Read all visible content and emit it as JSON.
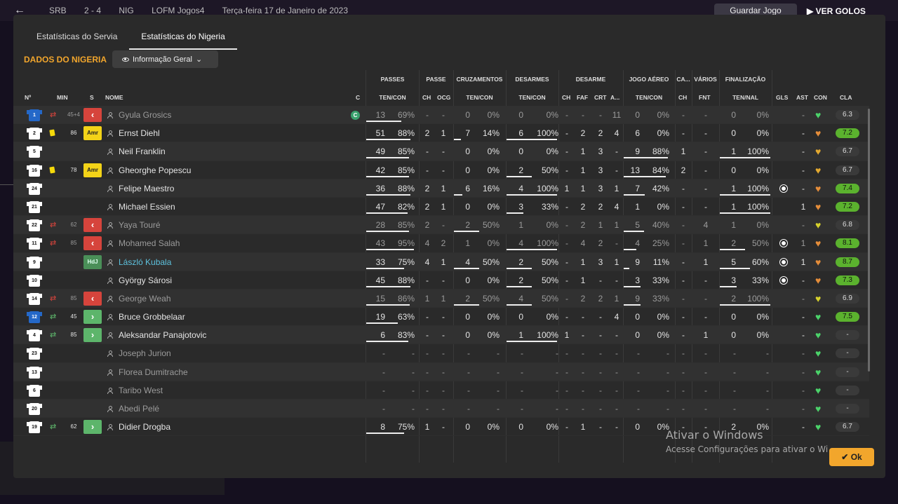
{
  "background": {
    "score_home": "SRB",
    "score": "2 - 4",
    "score_away": "NIG",
    "save_file": "LOFM Jogos4",
    "date": "Terça-feira 17 de Janeiro de 2023",
    "save_button": "Guardar Jogo",
    "view_goals": "VER GOLOS"
  },
  "tabs": [
    "Estatísticas do Servia",
    "Estatísticas do Nigeria"
  ],
  "section_title": "DADOS DO NIGERIA",
  "view_dropdown": "Informação Geral",
  "group_headers": [
    "PASSES",
    "PASSE",
    "CRUZAMENTOS",
    "DESARMES",
    "DESARME",
    "JOGO AÉREO",
    "CA...",
    "VÁRIOS",
    "FINALIZAÇÃO"
  ],
  "column_headers": [
    "Nº",
    "MIN",
    "S",
    "NOME",
    "C",
    "TEN/CON",
    "CH",
    "OCG",
    "TEN/CON",
    "TEN/CON",
    "CH",
    "FAF",
    "CRT",
    "A...",
    "TEN/CON",
    "CH",
    "FNT",
    "TEN/NAL",
    "GLS",
    "AST",
    "CON",
    "CLA"
  ],
  "players": [
    {
      "no": "1",
      "gk": true,
      "sub": "out",
      "min": "45+4",
      "badge": "red",
      "name": "Gyula Grosics",
      "dim": true,
      "captain": "C",
      "pas": [
        "13",
        "69%"
      ],
      "pch": "-",
      "pocg": "-",
      "cru": [
        "0",
        "0%"
      ],
      "des": [
        "0",
        "0%"
      ],
      "dch": "-",
      "faf": "-",
      "crt": "-",
      "a": "11",
      "aer": [
        "0",
        "0%"
      ],
      "ca": "-",
      "fnt": "-",
      "fin": [
        "0",
        "0%"
      ],
      "gls": "",
      "ast": "-",
      "con": "green",
      "cla": "6.3",
      "hi": false
    },
    {
      "no": "2",
      "card": true,
      "min": "86",
      "badge": "Amr",
      "name": "Ernst Diehl",
      "pas": [
        "51",
        "88%"
      ],
      "pch": "2",
      "pocg": "1",
      "cru": [
        "7",
        "14%"
      ],
      "des": [
        "6",
        "100%"
      ],
      "dch": "-",
      "faf": "2",
      "crt": "2",
      "a": "4",
      "aer": [
        "6",
        "0%"
      ],
      "ca": "-",
      "fnt": "-",
      "fin": [
        "0",
        "0%"
      ],
      "gls": "",
      "ast": "-",
      "con": "orange",
      "cla": "7.2",
      "hi": true
    },
    {
      "no": "5",
      "name": "Neil Franklin",
      "pas": [
        "49",
        "85%"
      ],
      "pch": "-",
      "pocg": "-",
      "cru": [
        "0",
        "0%"
      ],
      "des": [
        "0",
        "0%"
      ],
      "dch": "-",
      "faf": "1",
      "crt": "3",
      "a": "-",
      "aer": [
        "9",
        "88%"
      ],
      "ca": "1",
      "fnt": "-",
      "fin": [
        "1",
        "100%"
      ],
      "gls": "",
      "ast": "-",
      "con": "gold",
      "cla": "6.7",
      "hi": false
    },
    {
      "no": "16",
      "card": true,
      "min": "78",
      "badge": "Amr",
      "name": "Gheorghe Popescu",
      "pas": [
        "42",
        "85%"
      ],
      "pch": "-",
      "pocg": "-",
      "cru": [
        "0",
        "0%"
      ],
      "des": [
        "2",
        "50%"
      ],
      "dch": "-",
      "faf": "1",
      "crt": "3",
      "a": "-",
      "aer": [
        "13",
        "84%"
      ],
      "ca": "2",
      "fnt": "-",
      "fin": [
        "0",
        "0%"
      ],
      "gls": "",
      "ast": "-",
      "con": "gold",
      "cla": "6.7",
      "hi": false
    },
    {
      "no": "24",
      "name": "Felipe Maestro",
      "pas": [
        "36",
        "88%"
      ],
      "pch": "2",
      "pocg": "1",
      "cru": [
        "6",
        "16%"
      ],
      "des": [
        "4",
        "100%"
      ],
      "dch": "1",
      "faf": "1",
      "crt": "3",
      "a": "1",
      "aer": [
        "7",
        "42%"
      ],
      "ca": "-",
      "fnt": "-",
      "fin": [
        "1",
        "100%"
      ],
      "gls": "ball",
      "ast": "-",
      "con": "orange",
      "cla": "7.4",
      "hi": true
    },
    {
      "no": "21",
      "name": "Michael Essien",
      "pas": [
        "47",
        "82%"
      ],
      "pch": "2",
      "pocg": "1",
      "cru": [
        "0",
        "0%"
      ],
      "des": [
        "3",
        "33%"
      ],
      "dch": "-",
      "faf": "2",
      "crt": "2",
      "a": "4",
      "aer": [
        "1",
        "0%"
      ],
      "ca": "-",
      "fnt": "-",
      "fin": [
        "1",
        "100%"
      ],
      "gls": "",
      "ast": "1",
      "con": "orange",
      "cla": "7.2",
      "hi": true
    },
    {
      "no": "22",
      "sub": "out",
      "min": "62",
      "badge": "red",
      "name": "Yaya Touré",
      "dim": true,
      "pas": [
        "28",
        "85%"
      ],
      "pch": "2",
      "pocg": "-",
      "cru": [
        "2",
        "50%"
      ],
      "des": [
        "1",
        "0%"
      ],
      "dch": "-",
      "faf": "2",
      "crt": "1",
      "a": "1",
      "aer": [
        "5",
        "40%"
      ],
      "ca": "-",
      "fnt": "4",
      "fin": [
        "1",
        "0%"
      ],
      "gls": "",
      "ast": "-",
      "con": "yellow",
      "cla": "6.8",
      "hi": false
    },
    {
      "no": "11",
      "sub": "out",
      "min": "85",
      "badge": "red",
      "name": "Mohamed Salah",
      "dim": true,
      "pas": [
        "43",
        "95%"
      ],
      "pch": "4",
      "pocg": "2",
      "cru": [
        "1",
        "0%"
      ],
      "des": [
        "4",
        "100%"
      ],
      "dch": "-",
      "faf": "4",
      "crt": "2",
      "a": "-",
      "aer": [
        "4",
        "25%"
      ],
      "ca": "-",
      "fnt": "1",
      "fin": [
        "2",
        "50%"
      ],
      "gls": "ball",
      "ast": "1",
      "con": "orange",
      "cla": "8.1",
      "hi": true
    },
    {
      "no": "9",
      "badge": "HdJ",
      "name": "László Kubala",
      "link": true,
      "pas": [
        "33",
        "75%"
      ],
      "pch": "4",
      "pocg": "1",
      "cru": [
        "4",
        "50%"
      ],
      "des": [
        "2",
        "50%"
      ],
      "dch": "-",
      "faf": "1",
      "crt": "3",
      "a": "1",
      "aer": [
        "9",
        "11%"
      ],
      "ca": "-",
      "fnt": "1",
      "fin": [
        "5",
        "60%"
      ],
      "gls": "ball",
      "ast": "1",
      "con": "orange",
      "cla": "8.7",
      "hi": true
    },
    {
      "no": "10",
      "name": "György Sárosi",
      "pas": [
        "45",
        "88%"
      ],
      "pch": "-",
      "pocg": "-",
      "cru": [
        "0",
        "0%"
      ],
      "des": [
        "2",
        "50%"
      ],
      "dch": "-",
      "faf": "1",
      "crt": "-",
      "a": "-",
      "aer": [
        "3",
        "33%"
      ],
      "ca": "-",
      "fnt": "-",
      "fin": [
        "3",
        "33%"
      ],
      "gls": "ball",
      "ast": "-",
      "con": "orange",
      "cla": "7.3",
      "hi": true
    },
    {
      "no": "14",
      "sub": "out",
      "min": "85",
      "badge": "red",
      "name": "George Weah",
      "dim": true,
      "pas": [
        "15",
        "86%"
      ],
      "pch": "1",
      "pocg": "1",
      "cru": [
        "2",
        "50%"
      ],
      "des": [
        "4",
        "50%"
      ],
      "dch": "-",
      "faf": "2",
      "crt": "2",
      "a": "1",
      "aer": [
        "9",
        "33%"
      ],
      "ca": "-",
      "fnt": "-",
      "fin": [
        "2",
        "100%"
      ],
      "gls": "",
      "ast": "-",
      "con": "yellow",
      "cla": "6.9",
      "hi": false
    },
    {
      "no": "12",
      "gk": true,
      "sub": "in",
      "min": "45",
      "badge": "green",
      "name": "Bruce Grobbelaar",
      "pas": [
        "19",
        "63%"
      ],
      "pch": "-",
      "pocg": "-",
      "cru": [
        "0",
        "0%"
      ],
      "des": [
        "0",
        "0%"
      ],
      "dch": "-",
      "faf": "-",
      "crt": "-",
      "a": "4",
      "aer": [
        "0",
        "0%"
      ],
      "ca": "-",
      "fnt": "-",
      "fin": [
        "0",
        "0%"
      ],
      "gls": "",
      "ast": "-",
      "con": "green",
      "cla": "7.5",
      "hi": true
    },
    {
      "no": "4",
      "sub": "in",
      "min": "85",
      "badge": "green",
      "name": "Aleksandar Panajotovic",
      "pas": [
        "6",
        "83%"
      ],
      "pch": "-",
      "pocg": "-",
      "cru": [
        "0",
        "0%"
      ],
      "des": [
        "1",
        "100%"
      ],
      "dch": "1",
      "faf": "-",
      "crt": "-",
      "a": "-",
      "aer": [
        "0",
        "0%"
      ],
      "ca": "-",
      "fnt": "1",
      "fin": [
        "0",
        "0%"
      ],
      "gls": "",
      "ast": "-",
      "con": "green",
      "cla": "-",
      "hi": false
    },
    {
      "no": "23",
      "name": "Joseph Jurion",
      "dim": true,
      "pas": [
        "-",
        "-"
      ],
      "pch": "-",
      "pocg": "-",
      "cru": [
        "-",
        "-"
      ],
      "des": [
        "-",
        "-"
      ],
      "dch": "-",
      "faf": "-",
      "crt": "-",
      "a": "-",
      "aer": [
        "-",
        "-"
      ],
      "ca": "-",
      "fnt": "-",
      "fin": [
        "-",
        "-"
      ],
      "gls": "",
      "ast": "-",
      "con": "green",
      "cla": "-",
      "hi": false
    },
    {
      "no": "13",
      "name": "Florea Dumitrache",
      "dim": true,
      "pas": [
        "-",
        "-"
      ],
      "pch": "-",
      "pocg": "-",
      "cru": [
        "-",
        "-"
      ],
      "des": [
        "-",
        "-"
      ],
      "dch": "-",
      "faf": "-",
      "crt": "-",
      "a": "-",
      "aer": [
        "-",
        "-"
      ],
      "ca": "-",
      "fnt": "-",
      "fin": [
        "-",
        "-"
      ],
      "gls": "",
      "ast": "-",
      "con": "green",
      "cla": "-",
      "hi": false
    },
    {
      "no": "6",
      "name": "Taribo West",
      "dim": true,
      "pas": [
        "-",
        "-"
      ],
      "pch": "-",
      "pocg": "-",
      "cru": [
        "-",
        "-"
      ],
      "des": [
        "-",
        "-"
      ],
      "dch": "-",
      "faf": "-",
      "crt": "-",
      "a": "-",
      "aer": [
        "-",
        "-"
      ],
      "ca": "-",
      "fnt": "-",
      "fin": [
        "-",
        "-"
      ],
      "gls": "",
      "ast": "-",
      "con": "green",
      "cla": "-",
      "hi": false
    },
    {
      "no": "20",
      "name": "Abedi Pelé",
      "dim": true,
      "pas": [
        "-",
        "-"
      ],
      "pch": "-",
      "pocg": "-",
      "cru": [
        "-",
        "-"
      ],
      "des": [
        "-",
        "-"
      ],
      "dch": "-",
      "faf": "-",
      "crt": "-",
      "a": "-",
      "aer": [
        "-",
        "-"
      ],
      "ca": "-",
      "fnt": "-",
      "fin": [
        "-",
        "-"
      ],
      "gls": "",
      "ast": "-",
      "con": "green",
      "cla": "-",
      "hi": false
    },
    {
      "no": "19",
      "sub": "in",
      "min": "62",
      "badge": "green",
      "name": "Didier Drogba",
      "pas": [
        "8",
        "75%"
      ],
      "pch": "1",
      "pocg": "-",
      "cru": [
        "0",
        "0%"
      ],
      "des": [
        "0",
        "0%"
      ],
      "dch": "-",
      "faf": "1",
      "crt": "-",
      "a": "-",
      "aer": [
        "0",
        "0%"
      ],
      "ca": "-",
      "fnt": "-",
      "fin": [
        "2",
        "0%"
      ],
      "gls": "",
      "ast": "-",
      "con": "green",
      "cla": "6.7",
      "hi": false
    }
  ],
  "ok_label": "Ok",
  "watermark": {
    "line1": "Ativar o Windows",
    "line2": "Acesse Configurações para ativar o Wi"
  },
  "colors": {
    "accent": "#f2a62c",
    "rating_good": "#5bb22e",
    "sub_out": "#d6443c",
    "sub_in": "#5db56b",
    "link": "#5ec2de"
  }
}
